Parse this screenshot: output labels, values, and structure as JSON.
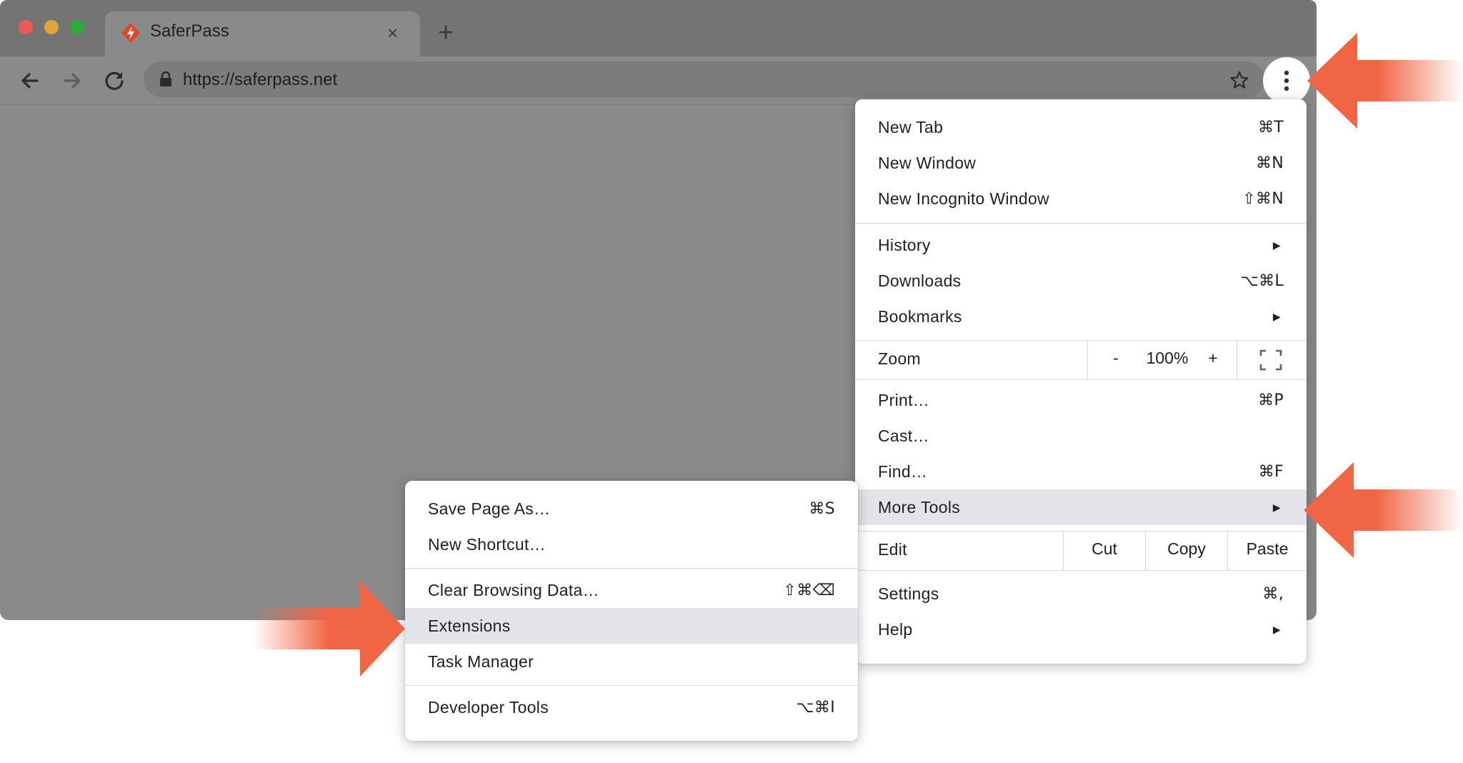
{
  "browser": {
    "tab_title": "SaferPass",
    "tab_close": "×",
    "new_tab": "+",
    "url": "https://saferpass.net",
    "icons": [
      "back-arrow-icon",
      "forward-arrow-icon",
      "reload-icon",
      "lock-icon",
      "star-icon",
      "kebab-menu-icon"
    ],
    "traffic_lights": [
      "#ee5a52",
      "#dfa536",
      "#29ab3d"
    ]
  },
  "main_menu": {
    "items": [
      {
        "label": "New Tab",
        "shortcut": "⌘T"
      },
      {
        "label": "New Window",
        "shortcut": "⌘N"
      },
      {
        "label": "New Incognito Window",
        "shortcut": "⇧⌘N"
      },
      {
        "label": "History",
        "submenu_arrow": "▶"
      },
      {
        "label": "Downloads",
        "shortcut": "⌥⌘L"
      },
      {
        "label": "Bookmarks",
        "submenu_arrow": "▶"
      },
      {
        "label": "Print…",
        "shortcut": "⌘P"
      },
      {
        "label": "Cast…"
      },
      {
        "label": "Find…",
        "shortcut": "⌘F"
      },
      {
        "label": "More Tools",
        "submenu_arrow": "▶",
        "highlighted": true
      },
      {
        "label": "Settings",
        "shortcut": "⌘,"
      },
      {
        "label": "Help",
        "submenu_arrow": "▶"
      }
    ],
    "zoom": {
      "label": "Zoom",
      "minus": "-",
      "level": "100%",
      "plus": "+"
    },
    "edit": {
      "label": "Edit",
      "cut": "Cut",
      "copy": "Copy",
      "paste": "Paste"
    }
  },
  "more_tools_menu": {
    "items": [
      {
        "label": "Save Page As…",
        "shortcut": "⌘S"
      },
      {
        "label": "New Shortcut…"
      },
      {
        "label": "Clear Browsing Data…",
        "shortcut": "⇧⌘⌫"
      },
      {
        "label": "Extensions",
        "highlighted": true
      },
      {
        "label": "Task Manager"
      },
      {
        "label": "Developer Tools",
        "shortcut": "⌥⌘I"
      }
    ]
  },
  "annotation_color": "#f06543"
}
